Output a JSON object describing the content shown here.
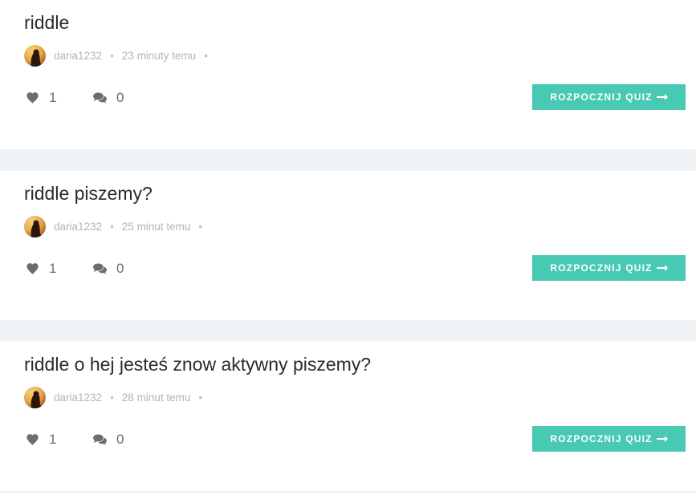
{
  "posts": [
    {
      "title": "riddle",
      "author": "daria1232",
      "time": "23 minuty temu",
      "likes": "1",
      "comments": "0",
      "button_label": "ROZPOCZNIJ QUIZ"
    },
    {
      "title": "riddle piszemy?",
      "author": "daria1232",
      "time": "25 minut temu",
      "likes": "1",
      "comments": "0",
      "button_label": "ROZPOCZNIJ QUIZ"
    },
    {
      "title": "riddle o hej jesteś znow aktywny piszemy?",
      "author": "daria1232",
      "time": "28 minut temu",
      "likes": "1",
      "comments": "0",
      "button_label": "ROZPOCZNIJ QUIZ"
    }
  ],
  "meta_separator": "•",
  "icons": {
    "like": "heart-icon",
    "comment": "comments-icon",
    "button": "long-arrow-right-icon"
  },
  "colors": {
    "accent": "#47c9b3",
    "separator_bg": "#f0f3f6",
    "muted_text": "#b4b4b4"
  }
}
